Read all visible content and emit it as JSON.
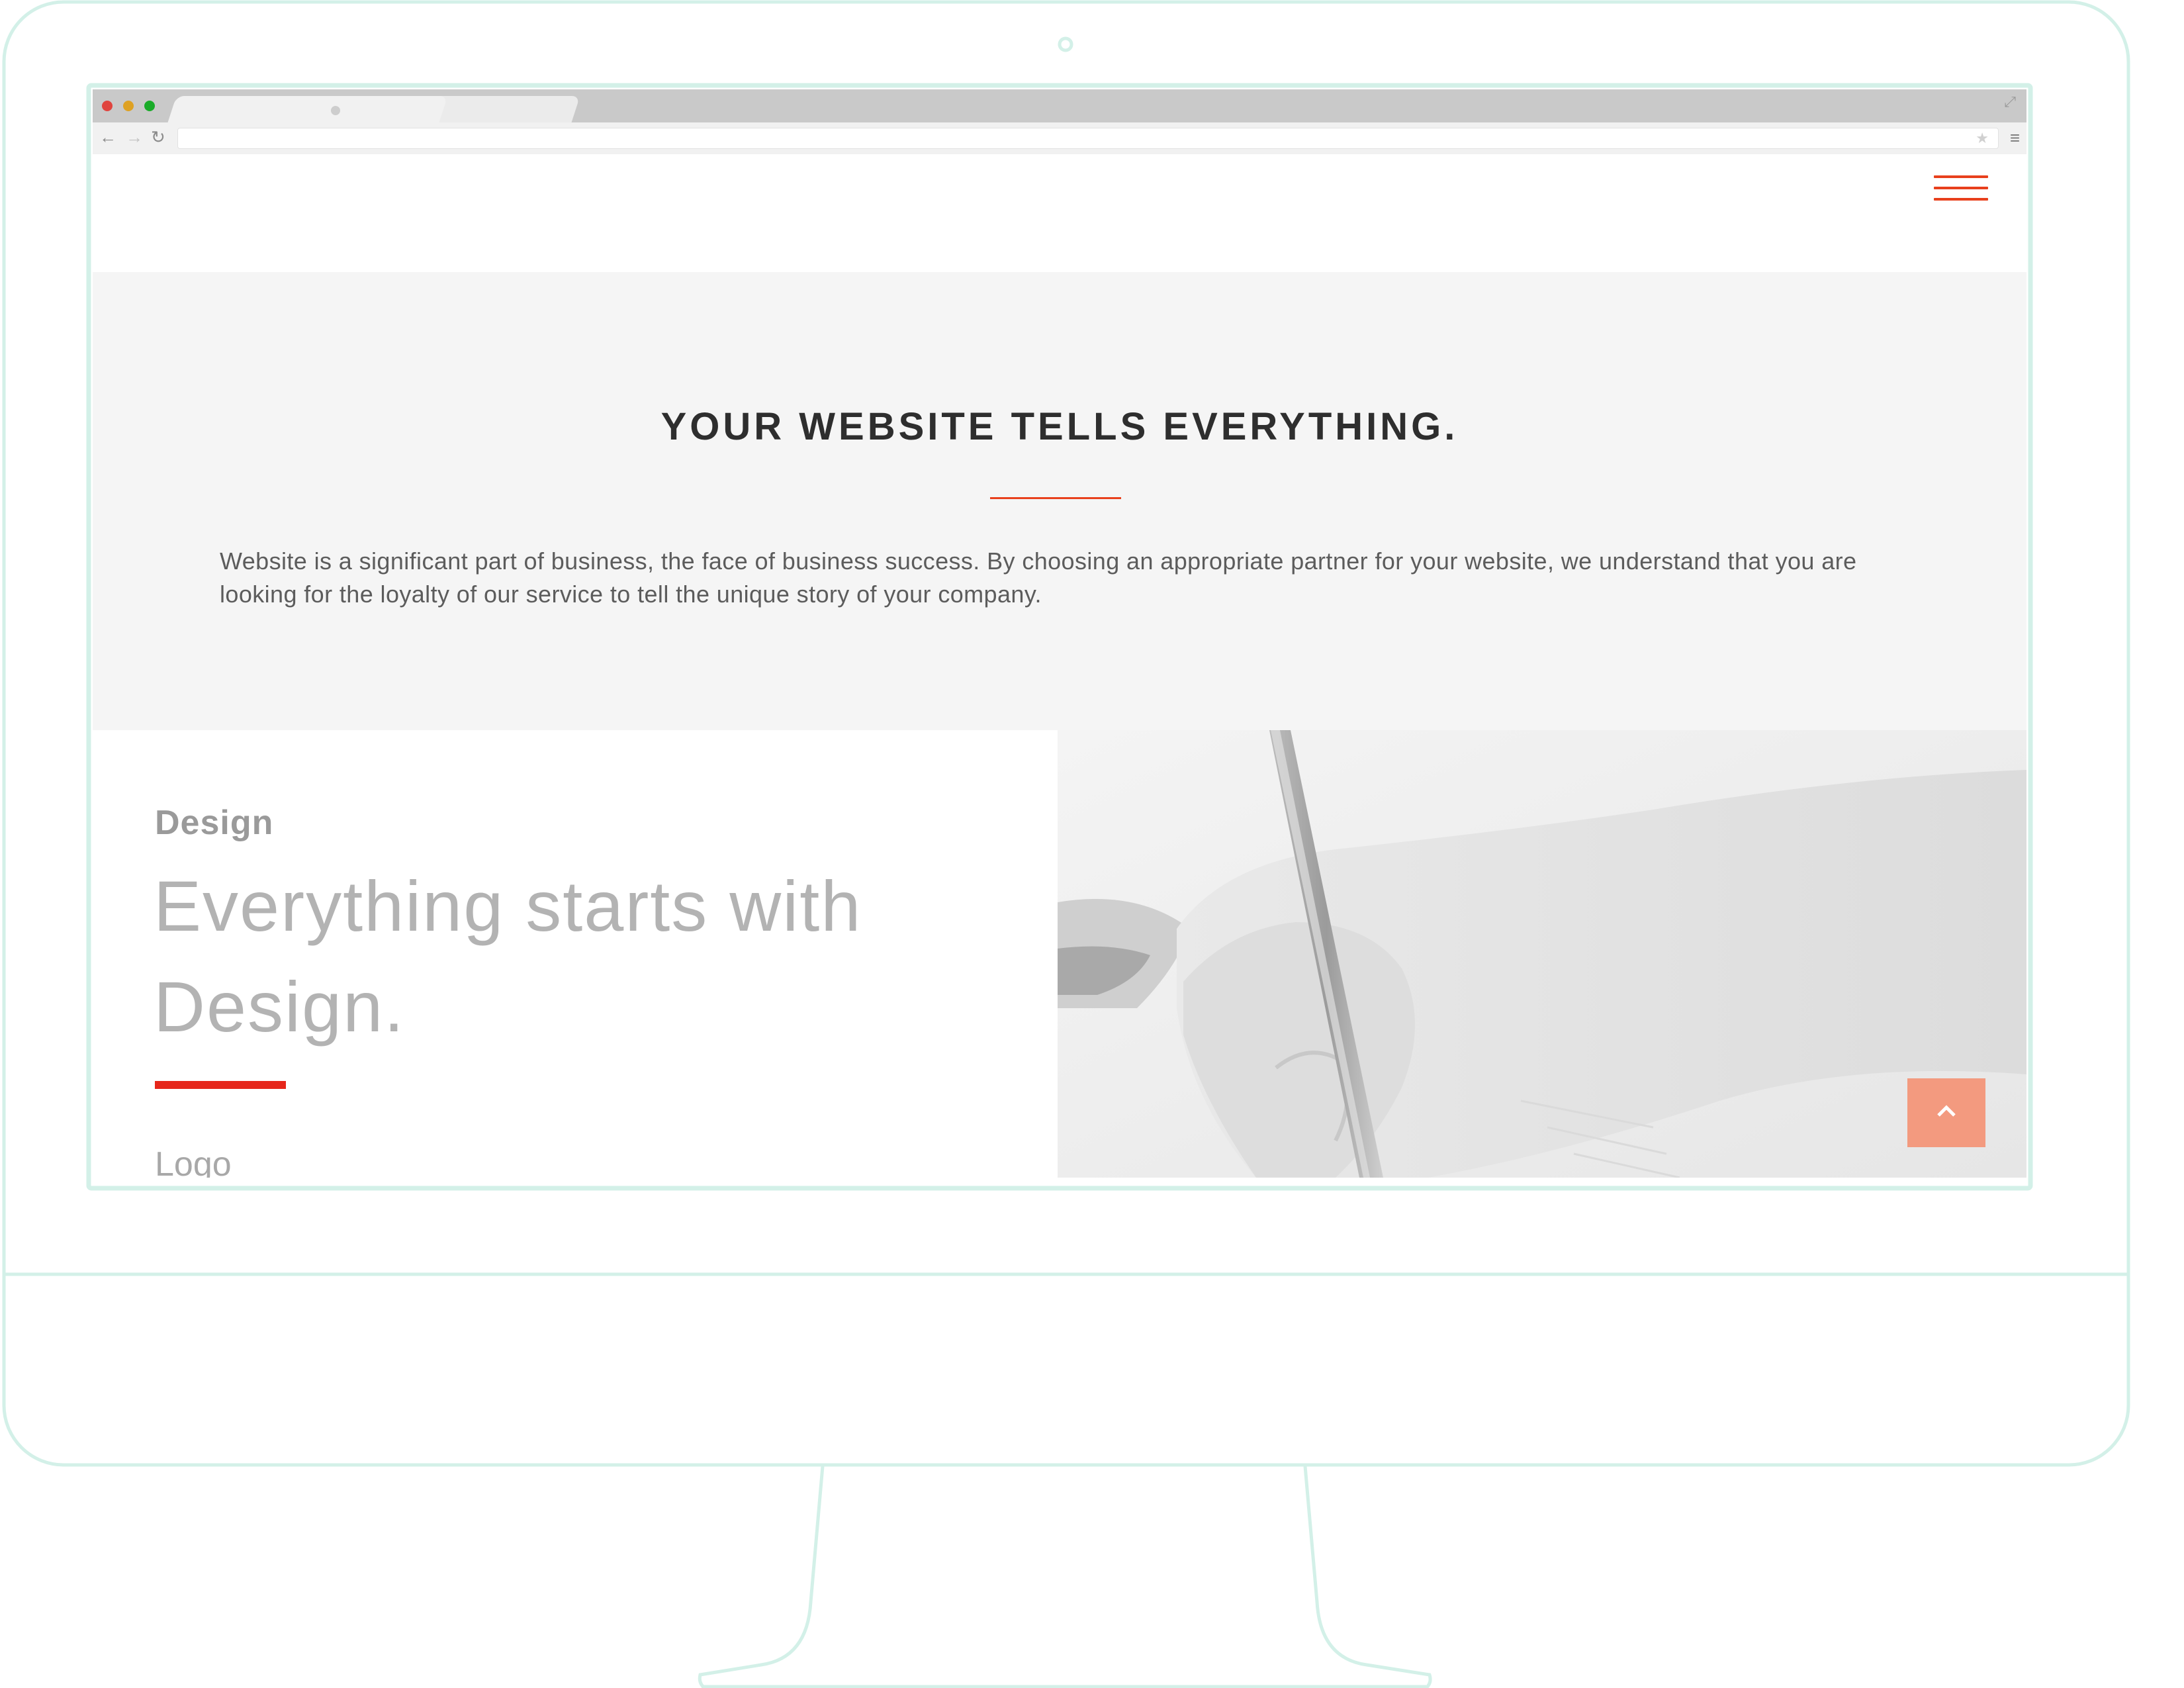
{
  "browser": {
    "colors": {
      "close": "#e0443e",
      "minimize": "#dea123",
      "maximize": "#1aab29",
      "chrome": "#c9c9c9",
      "toolbar": "#f1f1f1"
    },
    "icons": {
      "back": "arrow-left-icon",
      "forward": "arrow-right-icon",
      "reload": "reload-icon",
      "bookmark": "star-icon",
      "menu": "menu-icon",
      "fullscreen": "expand-icon"
    },
    "address": ""
  },
  "site": {
    "menu_icon": "hamburger-menu-icon",
    "accent": "#e8401c",
    "hero": {
      "title": "YOUR WEBSITE TELLS EVERYTHING.",
      "body": "Website is a significant part of business, the face of business success. By choosing an appropriate partner for your website, we understand that you are looking for the loyalty of our service to tell the unique story of your company."
    },
    "feature": {
      "label": "Design",
      "heading": "Everything starts with Design.",
      "next_label": "Logo",
      "image": "hand-writing-with-pen-photo"
    },
    "back_to_top": {
      "icon": "chevron-up-icon",
      "color": "#f39a7f"
    }
  }
}
